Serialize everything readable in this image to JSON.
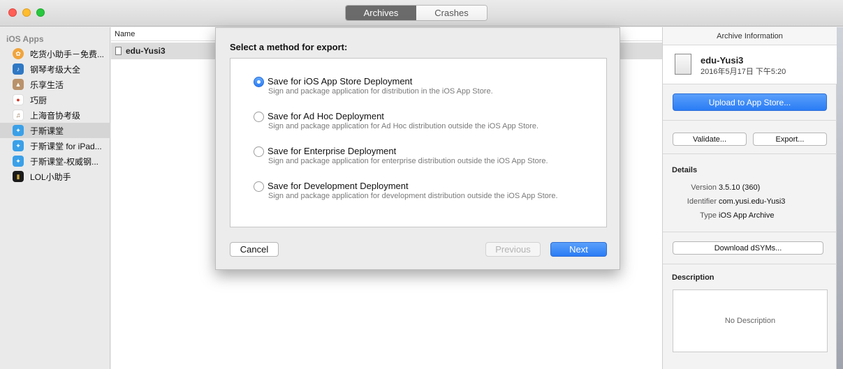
{
  "tabs": {
    "archives": "Archives",
    "crashes": "Crashes"
  },
  "sidebar": {
    "heading": "iOS Apps",
    "items": [
      {
        "label": "吃货小助手－免费...",
        "color": "#f0a43c"
      },
      {
        "label": "钢琴考级大全",
        "color": "#2f78c4"
      },
      {
        "label": "乐享生活",
        "color": "#b9926b"
      },
      {
        "label": "巧厨",
        "color": "#d23a2a"
      },
      {
        "label": "上海音协考级",
        "color": "#c8b79a"
      },
      {
        "label": "于斯课堂",
        "color": "#3aa0e8"
      },
      {
        "label": "于斯课堂 for iPad...",
        "color": "#3aa0e8"
      },
      {
        "label": "于斯课堂-权威钢...",
        "color": "#3aa0e8"
      },
      {
        "label": "LOL小助手",
        "color": "#1b1b1b"
      }
    ]
  },
  "list": {
    "column_name": "Name",
    "row_label": "edu-Yusi3"
  },
  "sheet": {
    "title": "Select a method for export:",
    "options": [
      {
        "label": "Save for iOS App Store Deployment",
        "desc": "Sign and package application for distribution in the iOS App Store."
      },
      {
        "label": "Save for Ad Hoc Deployment",
        "desc": "Sign and package application for Ad Hoc distribution outside the iOS App Store."
      },
      {
        "label": "Save for Enterprise Deployment",
        "desc": "Sign and package application for enterprise distribution outside the iOS App Store."
      },
      {
        "label": "Save for Development Deployment",
        "desc": "Sign and package application for development distribution outside the iOS App Store."
      }
    ],
    "cancel": "Cancel",
    "previous": "Previous",
    "next": "Next"
  },
  "panel": {
    "title": "Archive Information",
    "archive_name": "edu-Yusi3",
    "archive_date": "2016年5月17日 下午5:20",
    "upload": "Upload to App Store...",
    "validate": "Validate...",
    "export": "Export...",
    "details_title": "Details",
    "version_key": "Version",
    "version_val": "3.5.10 (360)",
    "identifier_key": "Identifier",
    "identifier_val": "com.yusi.edu-Yusi3",
    "type_key": "Type",
    "type_val": "iOS App Archive",
    "download_dsyms": "Download dSYMs...",
    "description_title": "Description",
    "no_description": "No Description"
  }
}
